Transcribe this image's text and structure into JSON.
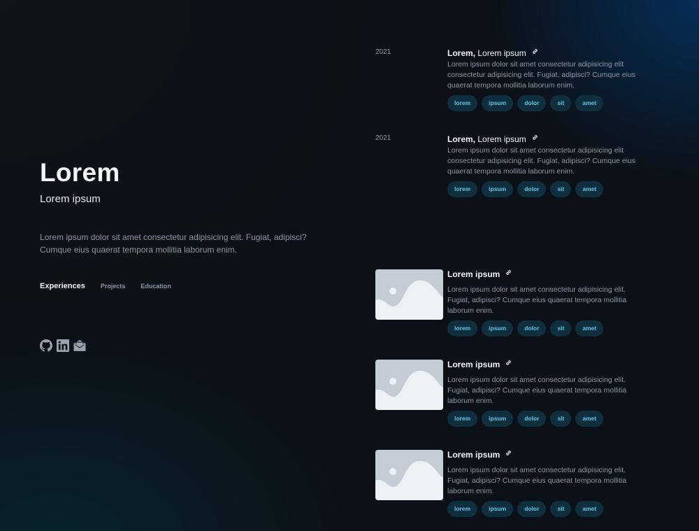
{
  "profile": {
    "name": "Lorem",
    "role": "Lorem ipsum",
    "bio": "Lorem ipsum dolor sit amet consectetur adipisicing elit. Fugiat, adipisci? Cumque eius quaerat tempora mollitia laborum enim."
  },
  "nav": {
    "items": [
      {
        "label": "Experiences",
        "active": true
      },
      {
        "label": "Projects",
        "active": false
      },
      {
        "label": "Education",
        "active": false
      }
    ]
  },
  "socials": [
    {
      "icon": "github-icon"
    },
    {
      "icon": "linkedin-icon"
    },
    {
      "icon": "mail-icon"
    }
  ],
  "experiences": [
    {
      "date": "2021",
      "title_bold": "Lorem,",
      "title_rest": " Lorem ipsum",
      "description": "Lorem ipsum dolor sit amet consectetur adipisicing elit consectetur adipisicing elit. Fugiat, adipisci? Cumque eius quaerat tempora mollitia laborum enim.",
      "tags": [
        "lorem",
        "ipsum",
        "dolor",
        "sit",
        "amet"
      ]
    },
    {
      "date": "2021",
      "title_bold": "Lorem,",
      "title_rest": " Lorem ipsum",
      "description": "Lorem ipsum dolor sit amet consectetur adipisicing elit consectetur adipisicing elit. Fugiat, adipisci? Cumque eius quaerat tempora mollitia laborum enim.",
      "tags": [
        "lorem",
        "ipsum",
        "dolor",
        "sit",
        "amet"
      ]
    }
  ],
  "projects": [
    {
      "title": "Lorem ipsum",
      "description": "Lorem ipsum dolor sit amet consectetur adipisicing elit. Fugiat, adipisci? Cumque eius quaerat tempora mollitia laborum enim.",
      "tags": [
        "lorem",
        "ipsum",
        "dolor",
        "sit",
        "amet"
      ]
    },
    {
      "title": "Lorem ipsum",
      "description": "Lorem ipsum dolor sit amet consectetur adipisicing elit. Fugiat, adipisci? Cumque eius quaerat tempora mollitia laborum enim.",
      "tags": [
        "lorem",
        "ipsum",
        "dolor",
        "sit",
        "amet"
      ]
    },
    {
      "title": "Lorem ipsum",
      "description": "Lorem ipsum dolor sit amet consectetur adipisicing elit. Fugiat, adipisci? Cumque eius quaerat tempora mollitia laborum enim.",
      "tags": [
        "lorem",
        "ipsum",
        "dolor",
        "sit",
        "amet"
      ]
    }
  ],
  "colors": {
    "background": "#0c1117",
    "accent": "#5ec6e8",
    "tag_bg": "#0f2f3f",
    "muted_text": "#8b95a3"
  }
}
